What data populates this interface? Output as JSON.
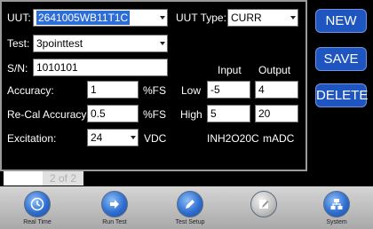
{
  "form": {
    "uut_label": "UUT:",
    "uut_value": "2641005WB11T1C",
    "uut_type_label": "UUT Type:",
    "uut_type_value": "CURR",
    "test_label": "Test:",
    "test_value": "3pointtest",
    "sn_label": "S/N:",
    "sn_value": "1010101",
    "input_header": "Input",
    "output_header": "Output",
    "accuracy_label": "Accuracy:",
    "accuracy_value": "1",
    "accuracy_unit": "%FS",
    "low_label": "Low",
    "low_input": "-5",
    "low_output": "4",
    "recal_label": "Re-Cal Accuracy:",
    "recal_value": "0.5",
    "recal_unit": "%FS",
    "high_label": "High",
    "high_input": "5",
    "high_output": "20",
    "excitation_label": "Excitation:",
    "excitation_value": "24",
    "excitation_unit": "VDC",
    "input_unit": "INH2O20C",
    "output_unit": "mADC"
  },
  "actions": {
    "new": "NEW",
    "save": "SAVE",
    "delete": "DELETE"
  },
  "pager": {
    "page": "2 of 2"
  },
  "nav": [
    {
      "label": "Real Time",
      "icon": "clock-icon"
    },
    {
      "label": "Run Test",
      "icon": "arrow-right-icon"
    },
    {
      "label": "Test Setup",
      "icon": "pencil-icon"
    },
    {
      "label": "",
      "icon": "edit-disabled-icon"
    },
    {
      "label": "System",
      "icon": "network-icon"
    }
  ],
  "colors": {
    "accent": "#1e55c0",
    "selection": "#2d6dd6",
    "background": "#000000"
  }
}
